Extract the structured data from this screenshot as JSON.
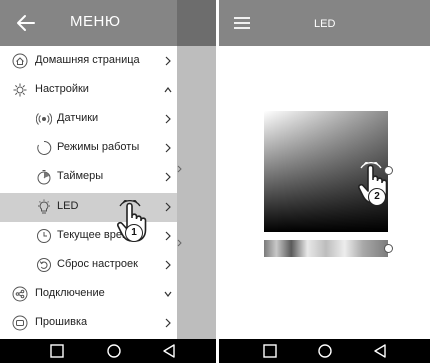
{
  "left": {
    "header_title": "МЕНЮ",
    "menu": [
      {
        "label": "Домашняя страница",
        "icon": "home-icon",
        "chevron": "right"
      },
      {
        "label": "Настройки",
        "icon": "settings-icon",
        "chevron": "up"
      },
      {
        "label": "Датчики",
        "icon": "sensor-icon",
        "chevron": "right"
      },
      {
        "label": "Режимы работы",
        "icon": "mode-icon",
        "chevron": "right"
      },
      {
        "label": "Таймеры",
        "icon": "timer-icon",
        "chevron": "right"
      },
      {
        "label": "LED",
        "icon": "bulb-icon",
        "chevron": "right"
      },
      {
        "label": "Текущее время",
        "icon": "clock-icon",
        "chevron": "right"
      },
      {
        "label": "Сброс настроек",
        "icon": "reset-icon",
        "chevron": "right"
      },
      {
        "label": "Подключение",
        "icon": "connection-icon",
        "chevron": "down"
      },
      {
        "label": "Прошивка",
        "icon": "firmware-icon",
        "chevron": "right"
      }
    ],
    "step_label": "1"
  },
  "right": {
    "header_title": "LED",
    "step_label": "2"
  },
  "colors": {
    "header": "#858585",
    "selected_row": "#cfcfcf",
    "nav_bar": "#000000",
    "drawer_overlay": "#bdbdbd"
  }
}
